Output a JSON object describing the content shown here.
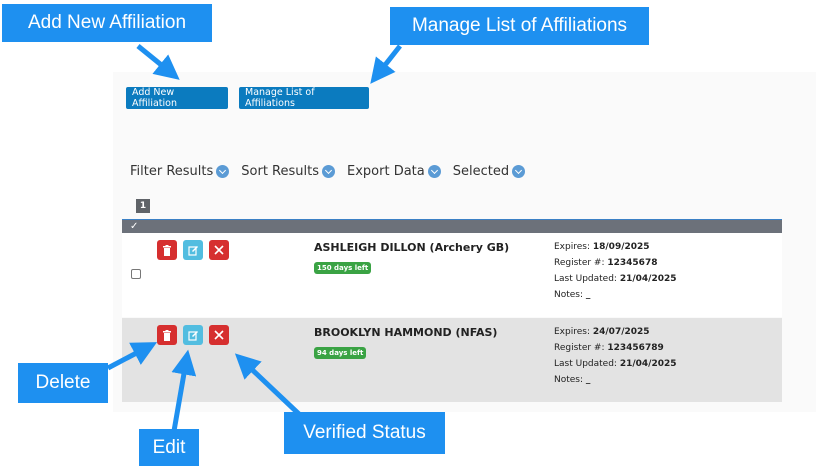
{
  "toolbar": {
    "add_label": "Add New Affiliation",
    "manage_label": "Manage List of Affiliations"
  },
  "filters": [
    {
      "label": "Filter Results"
    },
    {
      "label": "Sort Results"
    },
    {
      "label": "Export Data"
    },
    {
      "label": "Selected"
    }
  ],
  "pagination": {
    "current": "1"
  },
  "rows": [
    {
      "name": "ASHLEIGH DILLON (Archery GB)",
      "badge": "150 days left",
      "expires": "18/09/2025",
      "register": "12345678",
      "last_updated": "21/04/2025",
      "notes": "_"
    },
    {
      "name": "BROOKLYN HAMMOND (NFAS)",
      "badge": "94 days left",
      "expires": "24/07/2025",
      "register": "123456789",
      "last_updated": "21/04/2025",
      "notes": "_"
    }
  ],
  "labels": {
    "expires": "Expires:",
    "register": "Register #:",
    "last_updated": "Last Updated:",
    "notes": "Notes:"
  },
  "callouts": {
    "add": "Add New Affiliation",
    "manage": "Manage List of Affiliations",
    "delete": "Delete",
    "edit": "Edit",
    "verified": "Verified Status"
  },
  "colors": {
    "callout": "#1e90f0",
    "button_primary": "#0b7bbf",
    "delete": "#d62f2f",
    "edit": "#52bde0",
    "badge": "#3aa344"
  },
  "icons": {
    "delete": "trash-icon",
    "edit": "pencil-icon",
    "verified": "x-icon",
    "filter_toggle": "chevron-down-icon"
  }
}
